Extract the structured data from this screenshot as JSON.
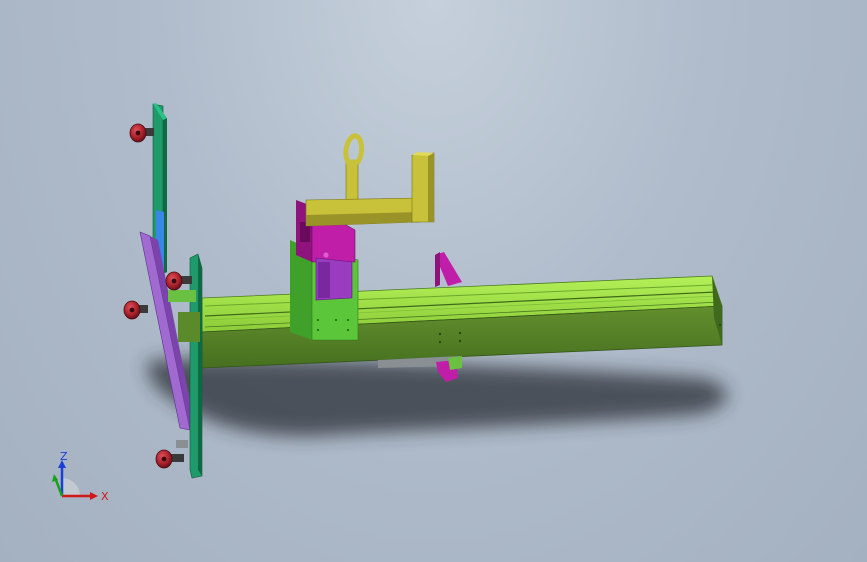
{
  "viewport": {
    "background_top": "#c6d0dc",
    "background_bottom": "#a4b1c1"
  },
  "colors": {
    "rail_light": "#8fd43c",
    "rail_top": "#a6e84a",
    "rail_side": "#5b8a2a",
    "rail_dark": "#3f6a1e",
    "carriage_green": "#5cc63a",
    "carriage_magenta": "#c01ea8",
    "carriage_purple": "#9a3cc0",
    "arm_yellow": "#c8c23a",
    "arm_yellow_dark": "#9a9428",
    "plate_teal": "#1f9a6a",
    "plate_purple": "#a06ad0",
    "plate_blue": "#3a86e6",
    "wheel_red": "#a8202a",
    "shadow": "#2a2f36"
  },
  "triad": {
    "z_label": "Z",
    "x_label": "X",
    "z_color": "#1a40d8",
    "x_color": "#d01818",
    "y_color": "#18a018"
  }
}
